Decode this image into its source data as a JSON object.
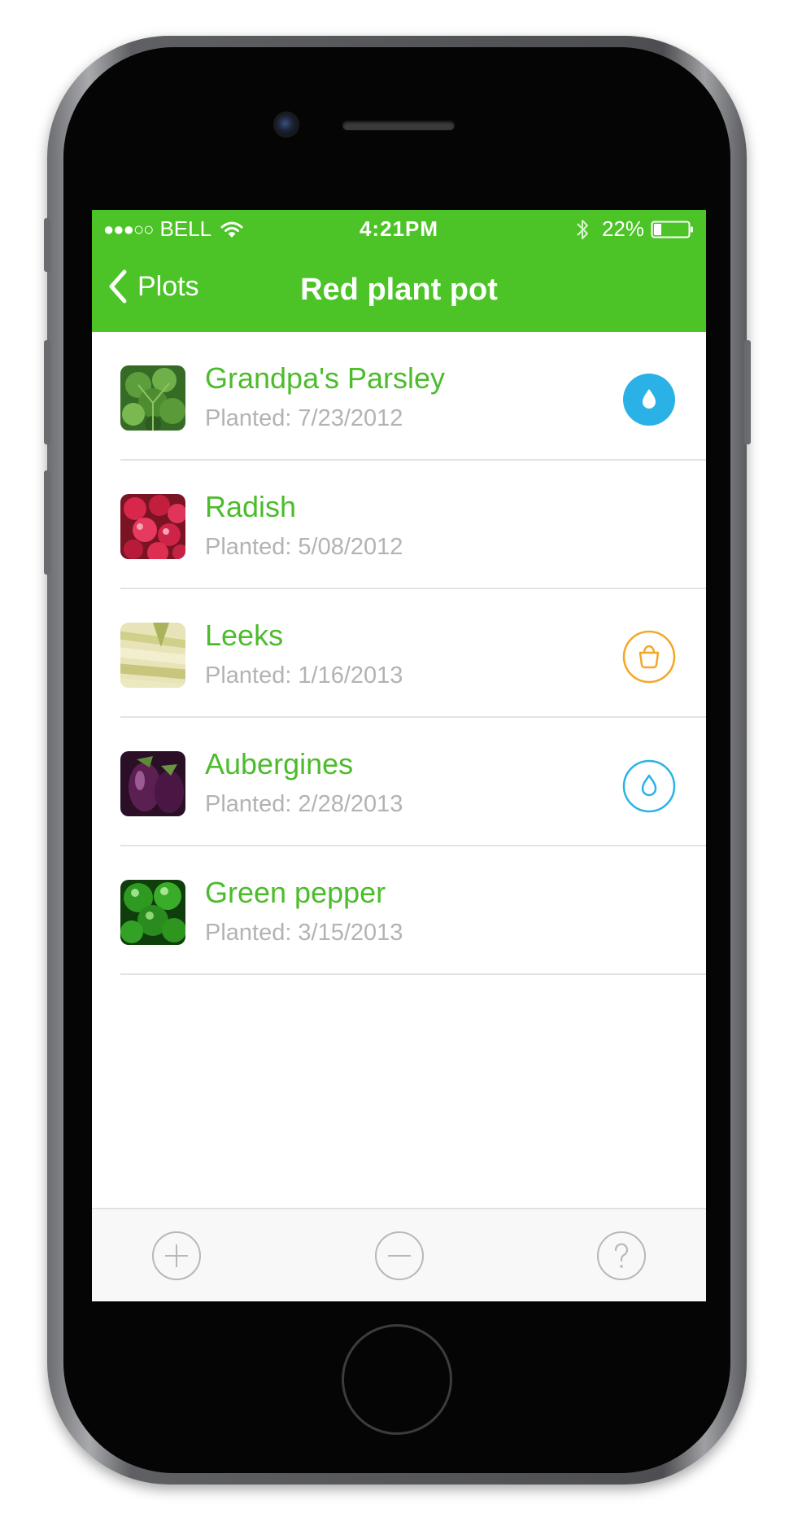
{
  "status_bar": {
    "signal": "●●●○○",
    "carrier": "BELL",
    "time": "4:21PM",
    "battery": "22%",
    "battery_level": 0.22
  },
  "nav": {
    "back_label": "Plots",
    "title": "Red plant pot"
  },
  "plants": [
    {
      "name": "Grandpa's Parsley",
      "planted_label": "Planted:",
      "date": "7/23/2012",
      "thumbnail": "parsley",
      "status_icon": "water-drop-filled-icon"
    },
    {
      "name": "Radish",
      "planted_label": "Planted:",
      "date": "5/08/2012",
      "thumbnail": "radish",
      "status_icon": null
    },
    {
      "name": "Leeks",
      "planted_label": "Planted:",
      "date": "1/16/2013",
      "thumbnail": "leeks",
      "status_icon": "harvest-basket-icon"
    },
    {
      "name": "Aubergines",
      "planted_label": "Planted:",
      "date": "2/28/2013",
      "thumbnail": "aubergine",
      "status_icon": "water-drop-outline-icon"
    },
    {
      "name": "Green pepper",
      "planted_label": "Planted:",
      "date": "3/15/2013",
      "thumbnail": "green-pepper",
      "status_icon": null
    }
  ],
  "toolbar": {
    "buttons": [
      "add-icon",
      "remove-icon",
      "help-icon"
    ]
  },
  "colors": {
    "accent_green": "#4cc427",
    "name_green": "#4cbc2b",
    "water_blue": "#2ab2e6",
    "harvest_orange": "#f5a623",
    "muted_gray": "#b3b3b3"
  }
}
